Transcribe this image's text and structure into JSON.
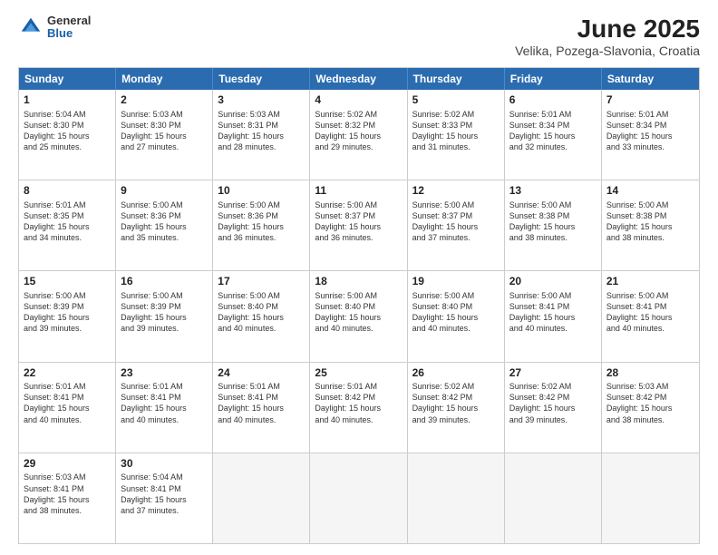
{
  "logo": {
    "general": "General",
    "blue": "Blue"
  },
  "title": "June 2025",
  "subtitle": "Velika, Pozega-Slavonia, Croatia",
  "header_days": [
    "Sunday",
    "Monday",
    "Tuesday",
    "Wednesday",
    "Thursday",
    "Friday",
    "Saturday"
  ],
  "rows": [
    [
      {
        "day": "1",
        "text": "Sunrise: 5:04 AM\nSunset: 8:30 PM\nDaylight: 15 hours\nand 25 minutes."
      },
      {
        "day": "2",
        "text": "Sunrise: 5:03 AM\nSunset: 8:30 PM\nDaylight: 15 hours\nand 27 minutes."
      },
      {
        "day": "3",
        "text": "Sunrise: 5:03 AM\nSunset: 8:31 PM\nDaylight: 15 hours\nand 28 minutes."
      },
      {
        "day": "4",
        "text": "Sunrise: 5:02 AM\nSunset: 8:32 PM\nDaylight: 15 hours\nand 29 minutes."
      },
      {
        "day": "5",
        "text": "Sunrise: 5:02 AM\nSunset: 8:33 PM\nDaylight: 15 hours\nand 31 minutes."
      },
      {
        "day": "6",
        "text": "Sunrise: 5:01 AM\nSunset: 8:34 PM\nDaylight: 15 hours\nand 32 minutes."
      },
      {
        "day": "7",
        "text": "Sunrise: 5:01 AM\nSunset: 8:34 PM\nDaylight: 15 hours\nand 33 minutes."
      }
    ],
    [
      {
        "day": "8",
        "text": "Sunrise: 5:01 AM\nSunset: 8:35 PM\nDaylight: 15 hours\nand 34 minutes."
      },
      {
        "day": "9",
        "text": "Sunrise: 5:00 AM\nSunset: 8:36 PM\nDaylight: 15 hours\nand 35 minutes."
      },
      {
        "day": "10",
        "text": "Sunrise: 5:00 AM\nSunset: 8:36 PM\nDaylight: 15 hours\nand 36 minutes."
      },
      {
        "day": "11",
        "text": "Sunrise: 5:00 AM\nSunset: 8:37 PM\nDaylight: 15 hours\nand 36 minutes."
      },
      {
        "day": "12",
        "text": "Sunrise: 5:00 AM\nSunset: 8:37 PM\nDaylight: 15 hours\nand 37 minutes."
      },
      {
        "day": "13",
        "text": "Sunrise: 5:00 AM\nSunset: 8:38 PM\nDaylight: 15 hours\nand 38 minutes."
      },
      {
        "day": "14",
        "text": "Sunrise: 5:00 AM\nSunset: 8:38 PM\nDaylight: 15 hours\nand 38 minutes."
      }
    ],
    [
      {
        "day": "15",
        "text": "Sunrise: 5:00 AM\nSunset: 8:39 PM\nDaylight: 15 hours\nand 39 minutes."
      },
      {
        "day": "16",
        "text": "Sunrise: 5:00 AM\nSunset: 8:39 PM\nDaylight: 15 hours\nand 39 minutes."
      },
      {
        "day": "17",
        "text": "Sunrise: 5:00 AM\nSunset: 8:40 PM\nDaylight: 15 hours\nand 40 minutes."
      },
      {
        "day": "18",
        "text": "Sunrise: 5:00 AM\nSunset: 8:40 PM\nDaylight: 15 hours\nand 40 minutes."
      },
      {
        "day": "19",
        "text": "Sunrise: 5:00 AM\nSunset: 8:40 PM\nDaylight: 15 hours\nand 40 minutes."
      },
      {
        "day": "20",
        "text": "Sunrise: 5:00 AM\nSunset: 8:41 PM\nDaylight: 15 hours\nand 40 minutes."
      },
      {
        "day": "21",
        "text": "Sunrise: 5:00 AM\nSunset: 8:41 PM\nDaylight: 15 hours\nand 40 minutes."
      }
    ],
    [
      {
        "day": "22",
        "text": "Sunrise: 5:01 AM\nSunset: 8:41 PM\nDaylight: 15 hours\nand 40 minutes."
      },
      {
        "day": "23",
        "text": "Sunrise: 5:01 AM\nSunset: 8:41 PM\nDaylight: 15 hours\nand 40 minutes."
      },
      {
        "day": "24",
        "text": "Sunrise: 5:01 AM\nSunset: 8:41 PM\nDaylight: 15 hours\nand 40 minutes."
      },
      {
        "day": "25",
        "text": "Sunrise: 5:01 AM\nSunset: 8:42 PM\nDaylight: 15 hours\nand 40 minutes."
      },
      {
        "day": "26",
        "text": "Sunrise: 5:02 AM\nSunset: 8:42 PM\nDaylight: 15 hours\nand 39 minutes."
      },
      {
        "day": "27",
        "text": "Sunrise: 5:02 AM\nSunset: 8:42 PM\nDaylight: 15 hours\nand 39 minutes."
      },
      {
        "day": "28",
        "text": "Sunrise: 5:03 AM\nSunset: 8:42 PM\nDaylight: 15 hours\nand 38 minutes."
      }
    ],
    [
      {
        "day": "29",
        "text": "Sunrise: 5:03 AM\nSunset: 8:41 PM\nDaylight: 15 hours\nand 38 minutes."
      },
      {
        "day": "30",
        "text": "Sunrise: 5:04 AM\nSunset: 8:41 PM\nDaylight: 15 hours\nand 37 minutes."
      },
      {
        "day": "",
        "text": ""
      },
      {
        "day": "",
        "text": ""
      },
      {
        "day": "",
        "text": ""
      },
      {
        "day": "",
        "text": ""
      },
      {
        "day": "",
        "text": ""
      }
    ]
  ]
}
